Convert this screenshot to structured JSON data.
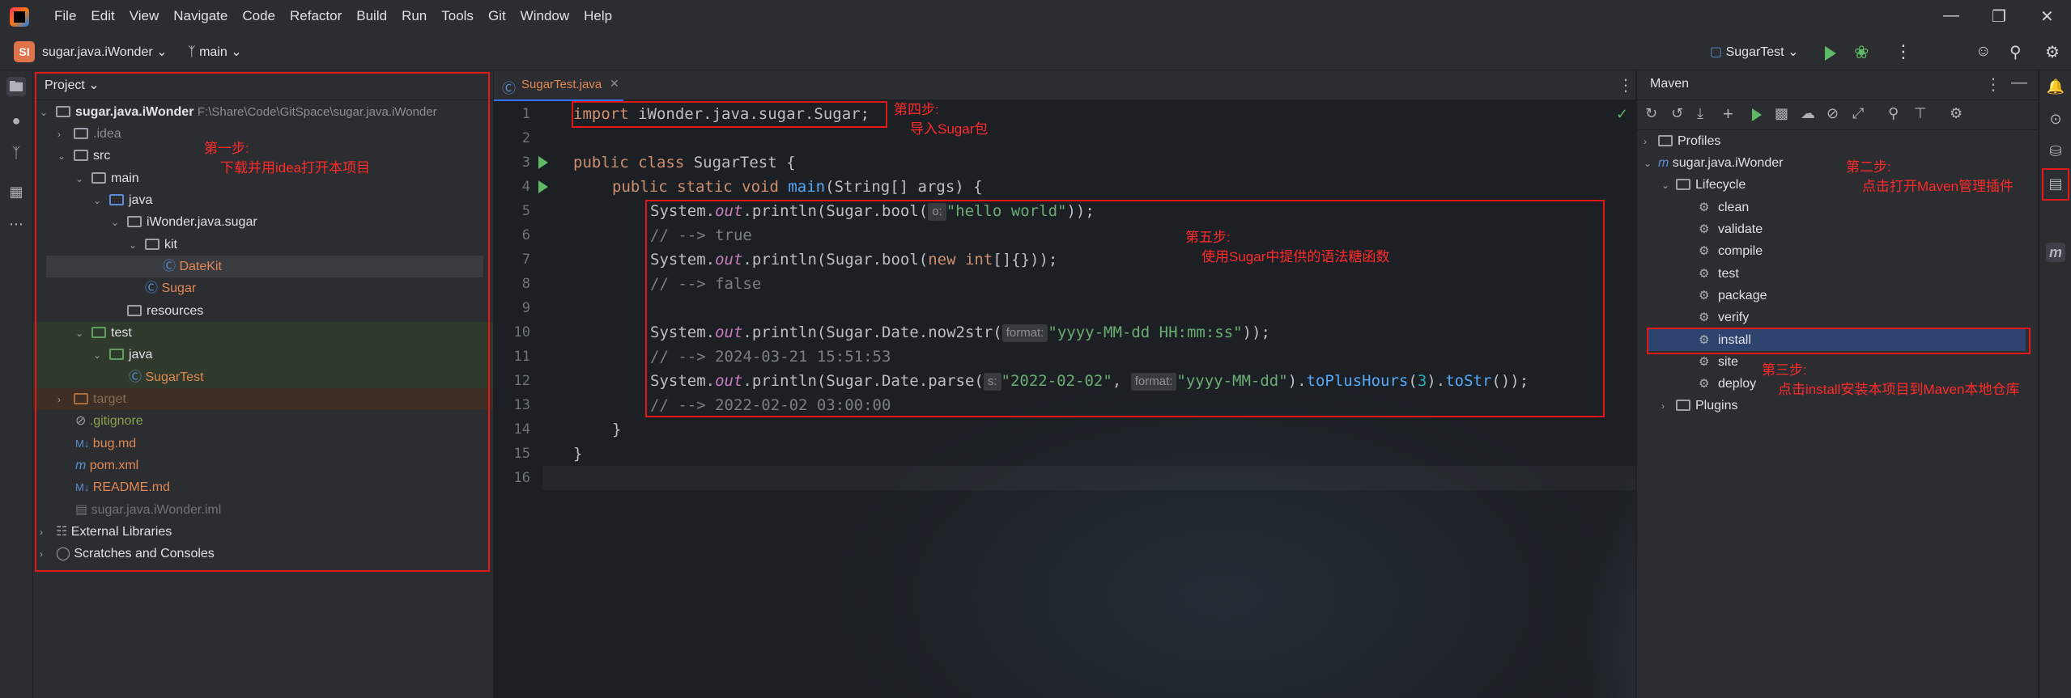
{
  "menu": [
    "File",
    "Edit",
    "View",
    "Navigate",
    "Code",
    "Refactor",
    "Build",
    "Run",
    "Tools",
    "Git",
    "Window",
    "Help"
  ],
  "toolbar": {
    "project_badge": "SI",
    "project_name": "sugar.java.iWonder",
    "branch": "main",
    "run_config": "SugarTest"
  },
  "project_panel": {
    "title": "Project",
    "tree": [
      {
        "label": "sugar.java.iWonder",
        "extra": "F:\\Share\\Code\\GitSpace\\sugar.java.iWonder"
      },
      {
        "label": ".idea"
      },
      {
        "label": "src"
      },
      {
        "label": "main"
      },
      {
        "label": "java"
      },
      {
        "label": "iWonder.java.sugar"
      },
      {
        "label": "kit"
      },
      {
        "label": "DateKit"
      },
      {
        "label": "Sugar"
      },
      {
        "label": "resources"
      },
      {
        "label": "test"
      },
      {
        "label": "java"
      },
      {
        "label": "SugarTest"
      },
      {
        "label": "target"
      },
      {
        "label": ".gitignore"
      },
      {
        "label": "bug.md"
      },
      {
        "label": "pom.xml"
      },
      {
        "label": "README.md"
      },
      {
        "label": "sugar.java.iWonder.iml"
      },
      {
        "label": "External Libraries"
      },
      {
        "label": "Scratches and Consoles"
      }
    ]
  },
  "editor": {
    "tab_label": "SugarTest.java",
    "line_numbers": [
      "1",
      "2",
      "3",
      "4",
      "5",
      "6",
      "7",
      "8",
      "9",
      "10",
      "11",
      "12",
      "13",
      "14",
      "15",
      "16"
    ],
    "lines": {
      "l1_kw": "import",
      "l1_rest": " iWonder.java.sugar.Sugar;",
      "l3_kw": "public class",
      "l3_rest": " SugarTest {",
      "l4_kw": "public static void",
      "l4_m": "main",
      "l4_rest": "(String[] args) {",
      "l5_a": "System.",
      "l5_out": "out",
      "l5_b": ".println(Sugar.",
      "l5_m": "bool",
      "l5_c": "(",
      "l5_hint": "o:",
      "l5_str": "\"hello world\"",
      "l5_d": "));",
      "l6": "// --> true",
      "l7_a": "System.",
      "l7_out": "out",
      "l7_b": ".println(Sugar.",
      "l7_m": "bool",
      "l7_c": "(",
      "l7_kw": "new int",
      "l7_d": "[]{}));",
      "l8": "// --> false",
      "l10_a": "System.",
      "l10_out": "out",
      "l10_b": ".println(Sugar.Date.",
      "l10_m": "now2str",
      "l10_c": "(",
      "l10_hint": "format:",
      "l10_str": "\"yyyy-MM-dd HH:mm:ss\"",
      "l10_d": "));",
      "l11": "// --> 2024-03-21 15:51:53",
      "l12_a": "System.",
      "l12_out": "out",
      "l12_b": ".println(Sugar.Date.",
      "l12_m": "parse",
      "l12_c": "(",
      "l12_hint1": "s:",
      "l12_str1": "\"2022-02-02\"",
      "l12_sep": ", ",
      "l12_hint2": "format:",
      "l12_str2": "\"yyyy-MM-dd\"",
      "l12_e": ").",
      "l12_m2": "toPlusHours",
      "l12_f": "(",
      "l12_num": "3",
      "l12_g": ").",
      "l12_m3": "toStr",
      "l12_h": "());",
      "l13": "// --> 2022-02-02 03:00:00",
      "l14": "}",
      "l15": "}"
    }
  },
  "maven_panel": {
    "title": "Maven",
    "items": {
      "profiles": "Profiles",
      "project": "sugar.java.iWonder",
      "lifecycle": "Lifecycle",
      "clean": "clean",
      "validate": "validate",
      "compile": "compile",
      "test": "test",
      "package": "package",
      "verify": "verify",
      "install": "install",
      "site": "site",
      "deploy": "deploy",
      "plugins": "Plugins"
    }
  },
  "annotations": {
    "step1_title": "第一步:",
    "step1_text": "下载并用idea打开本项目",
    "step2_title": "第二步:",
    "step2_text": "点击打开Maven管理插件",
    "step3_title": "第三步:",
    "step3_text": "点击install安装本项目到Maven本地仓库",
    "step4_title": "第四步:",
    "step4_text": "导入Sugar包",
    "step5_title": "第五步:",
    "step5_text": "使用Sugar中提供的语法糖函数"
  },
  "colors": {
    "accent": "#3574f0",
    "annotation_red": "#e01818",
    "selected_row": "#2e436e"
  }
}
